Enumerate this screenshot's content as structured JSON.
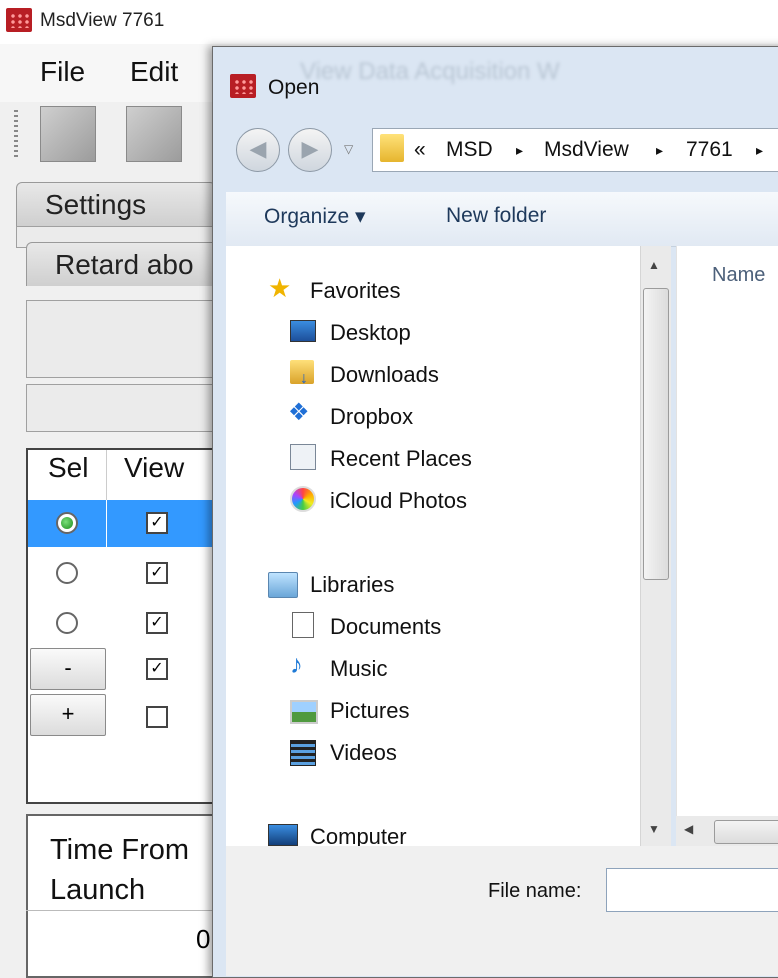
{
  "main_window": {
    "title": "MsdView  7761",
    "menu": [
      "File",
      "Edit"
    ],
    "tabs": {
      "settings": "Settings",
      "retard": "Retard abo"
    },
    "grid": {
      "headers": [
        "Sel",
        "View"
      ],
      "rows": [
        {
          "selected": true,
          "checked": true
        },
        {
          "selected": false,
          "checked": true
        },
        {
          "selected": false,
          "checked": true
        }
      ],
      "minus_label": "-",
      "plus_label": "+",
      "check_mark": "✓"
    },
    "time_panel": {
      "label": "Time From\nLaunch",
      "value": "0"
    },
    "accent_selection": "#3399ff"
  },
  "dialog": {
    "title": "Open",
    "ghost_menu": "View    Data Acquisition    W",
    "breadcrumb": [
      "«",
      "MSD",
      "▸",
      "MsdView",
      "▸",
      "7761",
      "▸"
    ],
    "commands": {
      "organize": "Organize ▾",
      "new_folder": "New folder"
    },
    "nav": {
      "favorites": "Favorites",
      "favorite_items": [
        "Desktop",
        "Downloads",
        "Dropbox",
        "Recent Places",
        "iCloud Photos"
      ],
      "libraries": "Libraries",
      "library_items": [
        "Documents",
        "Music",
        "Pictures",
        "Videos"
      ],
      "computer": "Computer"
    },
    "column_name": "Name",
    "file_name_label": "File name:",
    "file_name_value": ""
  }
}
